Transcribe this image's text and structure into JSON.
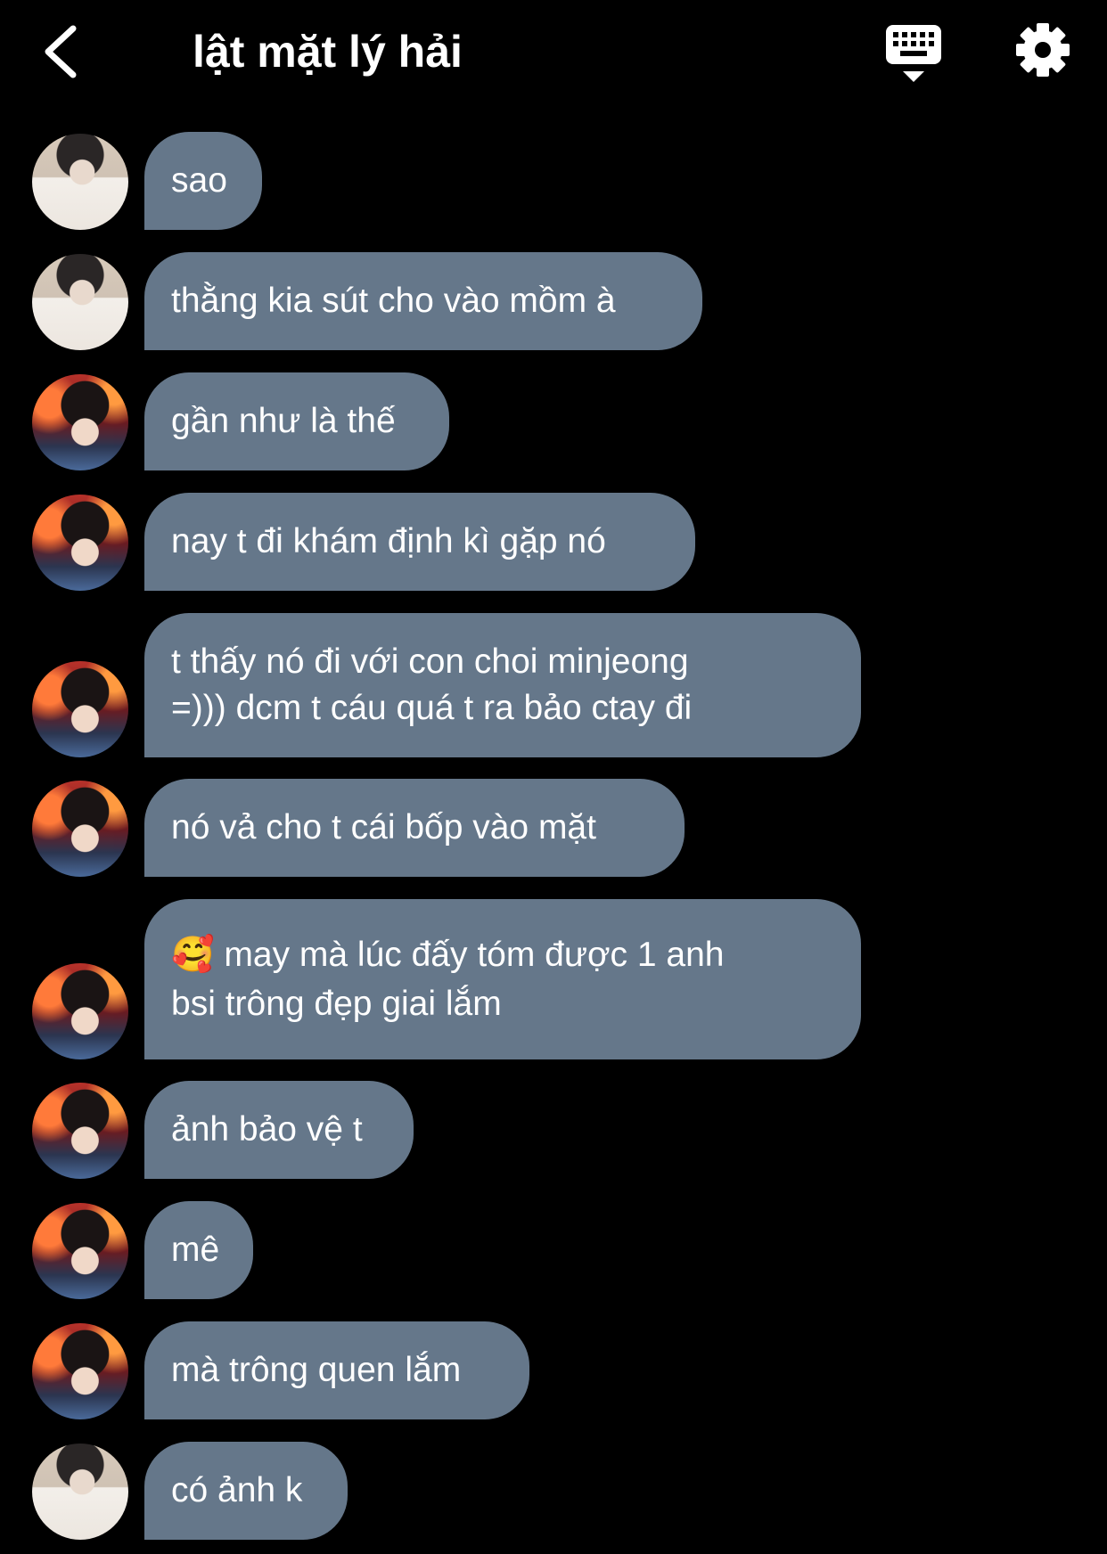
{
  "header": {
    "title": "lật mặt lý hải",
    "back_icon": "chevron-left-icon",
    "keyboard_icon": "keyboard-icon",
    "settings_icon": "gear-icon"
  },
  "colors": {
    "background": "#000000",
    "bubble": "#65778a",
    "text": "#ffffff"
  },
  "messages": [
    {
      "sender": "a",
      "text": "sao"
    },
    {
      "sender": "a",
      "text": "thằng kia sút cho vào mồm à"
    },
    {
      "sender": "b",
      "text": "gần như là thế"
    },
    {
      "sender": "b",
      "text": "nay t đi khám định kì gặp nó"
    },
    {
      "sender": "b",
      "text": "t thấy nó đi với con choi minjeong\n=))) dcm t cáu quá t ra bảo ctay đi"
    },
    {
      "sender": "b",
      "text": "nó vả cho t cái bốp vào mặt"
    },
    {
      "sender": "b",
      "text": "🥰 may mà lúc đấy tóm được 1 anh\nbsi trông đẹp giai lắm"
    },
    {
      "sender": "b",
      "text": "ảnh bảo vệ t"
    },
    {
      "sender": "b",
      "text": "mê"
    },
    {
      "sender": "b",
      "text": "mà trông quen lắm"
    },
    {
      "sender": "a",
      "text": "có ảnh k"
    }
  ]
}
